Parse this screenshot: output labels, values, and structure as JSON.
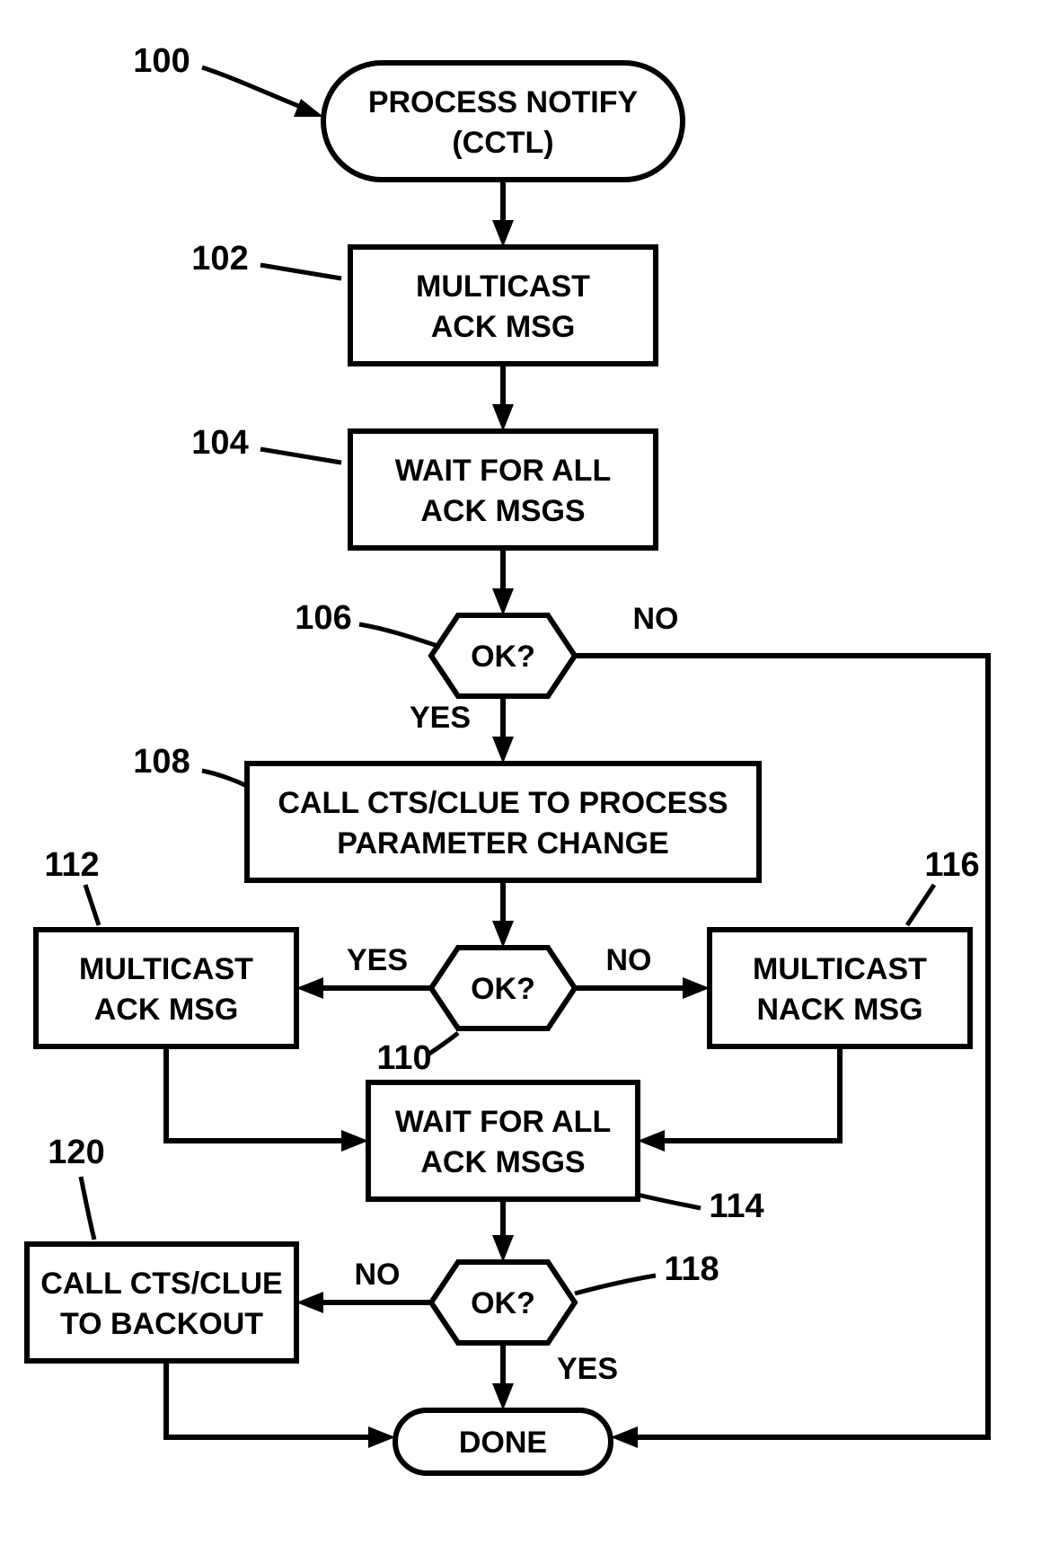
{
  "refs": {
    "r100": "100",
    "r102": "102",
    "r104": "104",
    "r106": "106",
    "r108": "108",
    "r110": "110",
    "r112": "112",
    "r114": "114",
    "r116": "116",
    "r118": "118",
    "r120": "120"
  },
  "nodes": {
    "start": {
      "l1": "PROCESS NOTIFY",
      "l2": "(CCTL)"
    },
    "n102": {
      "l1": "MULTICAST",
      "l2": "ACK MSG"
    },
    "n104": {
      "l1": "WAIT FOR ALL",
      "l2": "ACK MSGS"
    },
    "d106": {
      "l1": "OK?"
    },
    "n108": {
      "l1": "CALL CTS/CLUE TO PROCESS",
      "l2": "PARAMETER CHANGE"
    },
    "d110": {
      "l1": "OK?"
    },
    "n112": {
      "l1": "MULTICAST",
      "l2": "ACK MSG"
    },
    "n116": {
      "l1": "MULTICAST",
      "l2": "NACK MSG"
    },
    "n114": {
      "l1": "WAIT FOR ALL",
      "l2": "ACK MSGS"
    },
    "d118": {
      "l1": "OK?"
    },
    "n120": {
      "l1": "CALL CTS/CLUE",
      "l2": "TO BACKOUT"
    },
    "done": {
      "l1": "DONE"
    }
  },
  "labels": {
    "yes": "YES",
    "no": "NO"
  }
}
